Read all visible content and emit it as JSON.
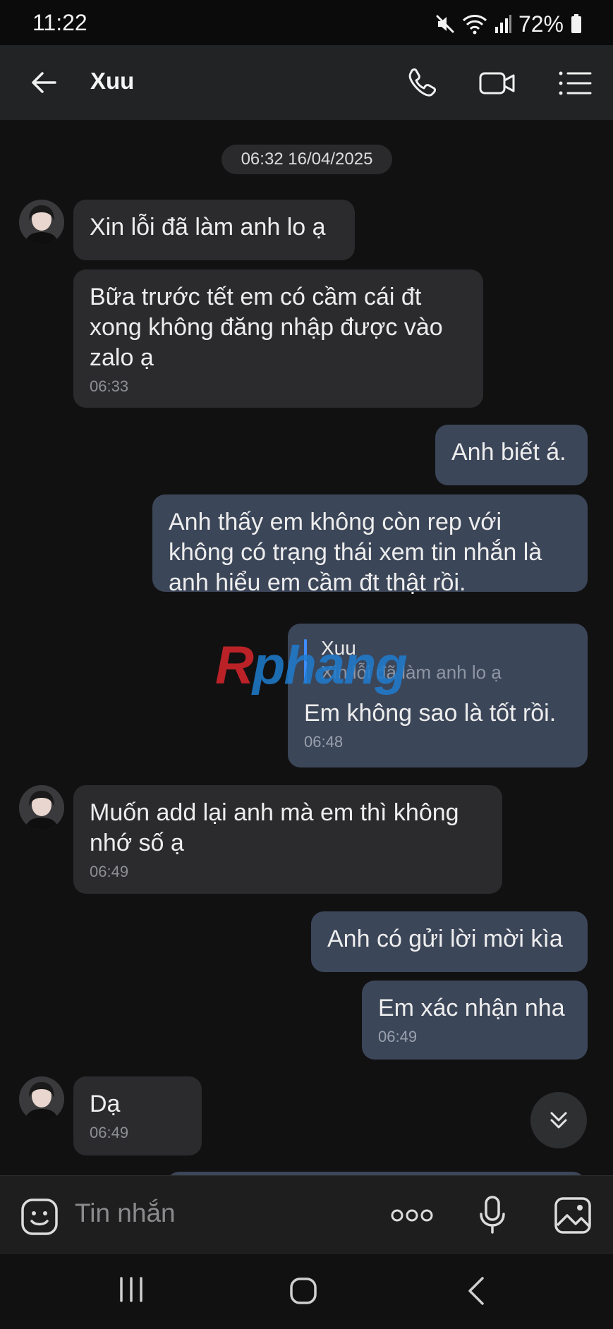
{
  "status_bar": {
    "time": "11:22",
    "battery": "72%"
  },
  "header": {
    "contact_name": "Xuu"
  },
  "chat": {
    "date_divider": "06:32 16/04/2025",
    "messages": [
      {
        "direction": "in",
        "text": "Xin lỗi đã làm anh lo ạ",
        "time": ""
      },
      {
        "direction": "in",
        "text": "Bữa trước tết em có cầm cái đt xong không đăng nhập được vào zalo ạ",
        "time": "06:33"
      },
      {
        "direction": "out",
        "text": "Anh biết á.",
        "time": ""
      },
      {
        "direction": "out",
        "text": "Anh thấy em không còn rep với không có trạng thái xem tin nhắn là anh hiểu em cầm đt thật rồi.",
        "time": ""
      },
      {
        "direction": "out",
        "quote_name": "Xuu",
        "quote_text": "Xin lỗi đã làm anh lo ạ",
        "text": "Em không sao là tốt rồi.",
        "time": "06:48"
      },
      {
        "direction": "in",
        "text": "Muốn add lại anh mà em thì không nhớ số ạ",
        "time": "06:49"
      },
      {
        "direction": "out",
        "text": "Anh có gửi lời mời kìa",
        "time": ""
      },
      {
        "direction": "out",
        "text": "Em xác nhận nha",
        "time": "06:49"
      },
      {
        "direction": "in",
        "text": "Dạ",
        "time": "06:49"
      }
    ],
    "watermark": {
      "part1": "R",
      "part2": "phang"
    }
  },
  "input": {
    "placeholder": "Tin nhắn"
  },
  "colors": {
    "incoming_bubble": "#2b2b2d",
    "outgoing_bubble": "#3c4659",
    "quote_bar": "#3f8cff",
    "header_bg": "#222324"
  },
  "icons": [
    "back-arrow-icon",
    "phone-icon",
    "video-call-icon",
    "menu-list-icon",
    "emoji-sticker-icon",
    "more-dots-icon",
    "microphone-icon",
    "image-icon",
    "scroll-down-icon",
    "recent-apps-icon",
    "home-icon",
    "nav-back-icon",
    "mute-icon",
    "wifi-icon",
    "signal-icon",
    "battery-icon"
  ]
}
